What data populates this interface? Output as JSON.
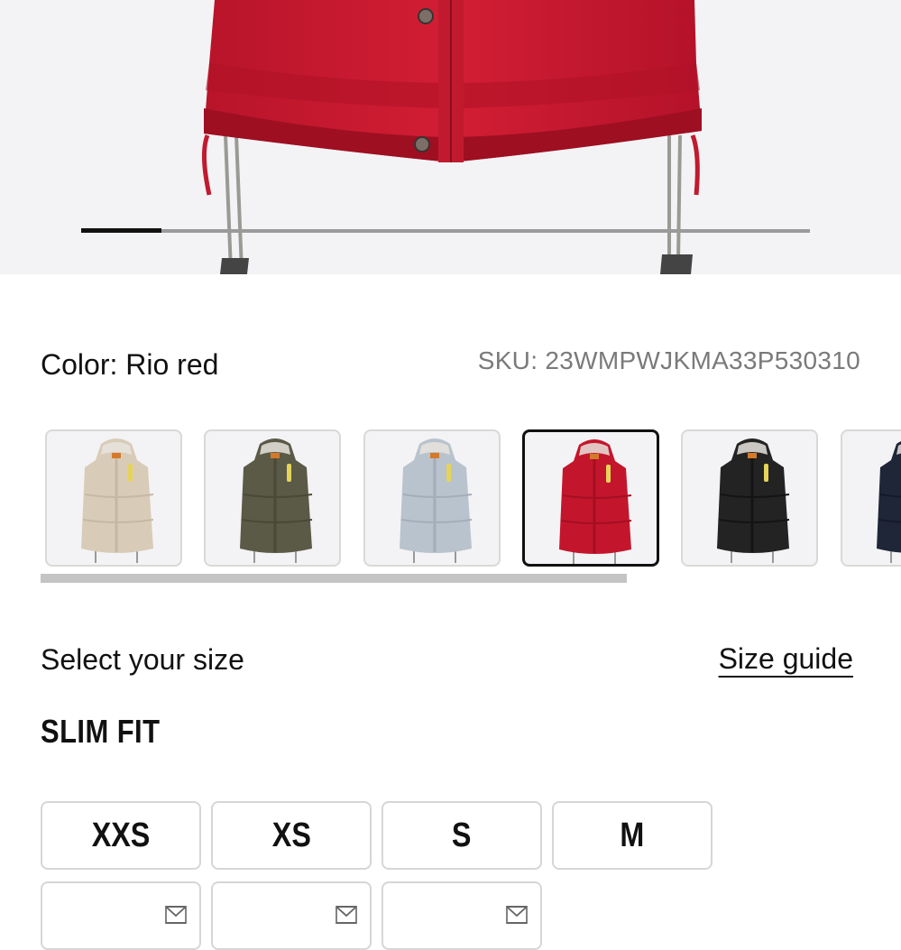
{
  "color": {
    "label": "Color: Rio red"
  },
  "sku": {
    "label": "SKU: 23WMPWJKMA33P530310"
  },
  "carousel": {
    "position": 0.11
  },
  "swatches": [
    {
      "name": "cream",
      "color": "#d8ccb8",
      "shade": "#c6b9a3"
    },
    {
      "name": "olive",
      "color": "#5b5a47",
      "shade": "#4a4938"
    },
    {
      "name": "light-blue",
      "color": "#b9c3cd",
      "shade": "#a3aeb9"
    },
    {
      "name": "rio-red",
      "color": "#c3162c",
      "shade": "#a40f22",
      "selected": true
    },
    {
      "name": "black",
      "color": "#232323",
      "shade": "#141414"
    },
    {
      "name": "navy",
      "color": "#1f2638",
      "shade": "#141a29"
    }
  ],
  "size_section": {
    "prompt": "Select your size",
    "guide": "Size guide",
    "fit": "SLIM FIT"
  },
  "sizes": [
    {
      "label": "XXS"
    },
    {
      "label": "XS"
    },
    {
      "label": "S"
    },
    {
      "label": "M"
    },
    {
      "label": "",
      "notify_icon": "mail-icon"
    },
    {
      "label": "",
      "notify_icon": "mail-icon"
    },
    {
      "label": "",
      "notify_icon": "mail-icon"
    }
  ],
  "accent": "#111111"
}
